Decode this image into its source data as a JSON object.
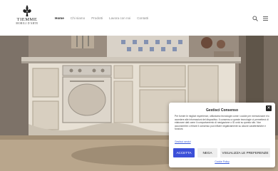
{
  "logo": {
    "name": "TIEMME",
    "subtitle": "MOBILI D'ARTE"
  },
  "nav": {
    "items": [
      {
        "label": "Home",
        "active": true
      },
      {
        "label": "Chi siamo",
        "active": false
      },
      {
        "label": "Prodotti",
        "active": false
      },
      {
        "label": "Lavora con noi",
        "active": false
      },
      {
        "label": "Contatti",
        "active": false
      }
    ]
  },
  "icons": {
    "search": "search-icon",
    "menu": "menu-icon",
    "close": "close-icon",
    "logo": "fleur-de-lis-icon"
  },
  "cookie": {
    "title": "Gestisci Consenso",
    "close": "✕",
    "body": "Per fornire le migliori esperienze, utilizziamo tecnologie come i cookie per memorizzare e/o accedere alle informazioni del dispositivo. Il consenso a queste tecnologie ci permetterà di elaborare dati come il comportamento di navigazione o ID unici su questo sito. Non acconsentire o ritirare il consenso può influire negativamente su alcune caratteristiche e funzioni.",
    "link": "Gestisci servizi",
    "accept": "ACCETTA",
    "deny": "NEGA",
    "preferences": "VISUALIZZA LE PREFERENZE",
    "policy": "Cookie Policy"
  },
  "colors": {
    "accent": "#3b4fd8",
    "link": "#3b5bd9"
  }
}
